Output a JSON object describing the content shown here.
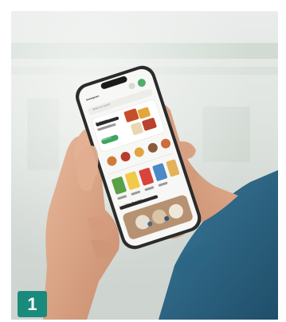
{
  "step_badge": {
    "number": "1",
    "color": "#1a8a7c"
  },
  "phone_screen": {
    "header_left": "Sweetgreen",
    "search_placeholder": "What's for lunch?",
    "featured_title": "Bodegaxx",
    "featured_subtitle": "Fresh groceries",
    "featured_button": "Order now",
    "section_title": "Local Bag Regulars"
  }
}
